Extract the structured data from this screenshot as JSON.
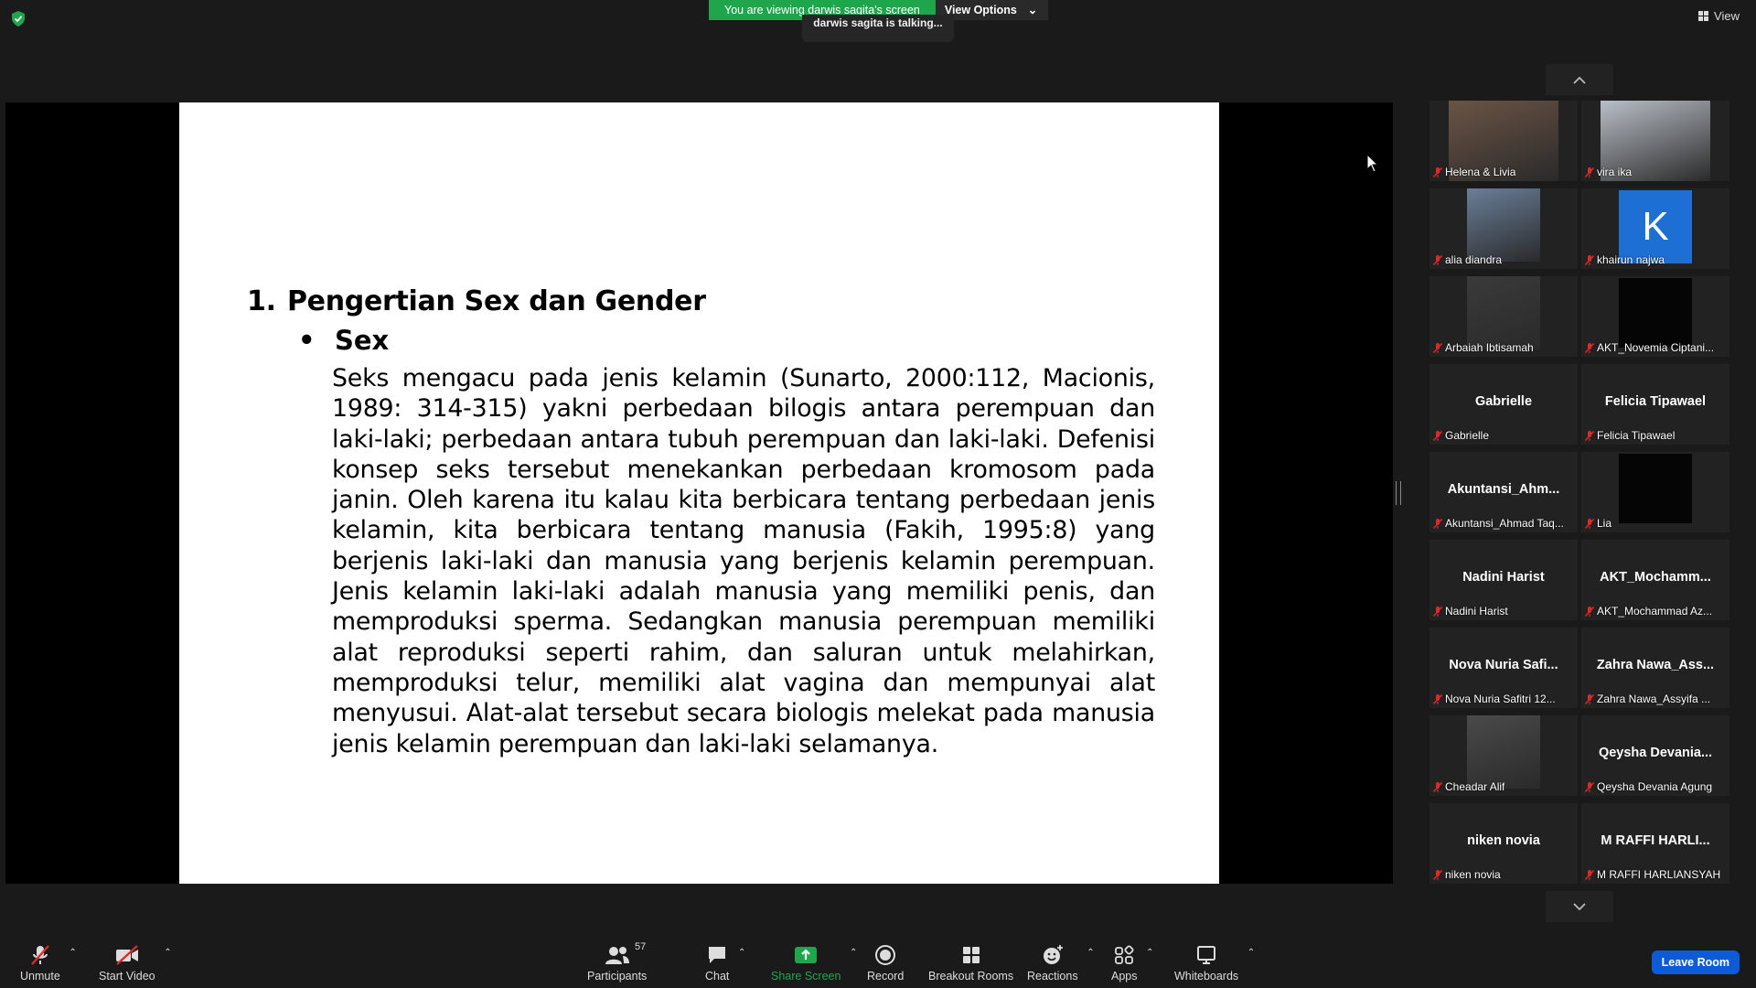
{
  "top": {
    "banner_text": "You are viewing darwis sagita's screen",
    "view_options_label": "View Options",
    "talking_text": "darwis sagita is talking...",
    "view_label": "View"
  },
  "slide": {
    "heading_number": "1.",
    "heading": "Pengertian Sex dan Gender",
    "bullet": "•",
    "subheading": "Sex",
    "body": "Seks mengacu pada jenis kelamin (Sunarto, 2000:112, Macionis, 1989: 314-315) yakni perbedaan bilogis antara perempuan dan laki-laki; perbedaan antara tubuh perempuan dan laki-laki. Defenisi konsep seks tersebut menekankan perbedaan kromosom pada janin. Oleh karena itu kalau kita berbicara tentang perbedaan jenis kelamin, kita berbicara tentang manusia (Fakih, 1995:8) yang berjenis laki-laki dan manusia yang berjenis kelamin perempuan. Jenis kelamin laki-laki adalah manusia yang memiliki penis, dan memproduksi sperma. Sedangkan manusia perempuan memiliki alat reproduksi seperti rahim, dan saluran untuk melahirkan, memproduksi telur, memiliki alat vagina dan mempunyai alat menyusui. Alat-alat tersebut secara biologis melekat pada manusia jenis kelamin perempuan dan laki-laki selamanya."
  },
  "participants": [
    {
      "label": "Helena & Livia",
      "display": "",
      "kind": "video"
    },
    {
      "label": "vira ika",
      "display": "",
      "kind": "video"
    },
    {
      "label": "alia diandra",
      "display": "",
      "kind": "video"
    },
    {
      "label": "khairun najwa",
      "display": "K",
      "kind": "avatar"
    },
    {
      "label": "Arbaiah Ibtisamah",
      "display": "",
      "kind": "video"
    },
    {
      "label": "AKT_Novemia Ciptani...",
      "display": "",
      "kind": "dark"
    },
    {
      "label": "Gabrielle",
      "display": "Gabrielle",
      "kind": "name"
    },
    {
      "label": "Felicia Tipawael",
      "display": "Felicia Tipawael",
      "kind": "name"
    },
    {
      "label": "Akuntansi_Ahmad Taq...",
      "display": "Akuntansi_Ahm...",
      "kind": "name"
    },
    {
      "label": "Lia",
      "display": "",
      "kind": "dark"
    },
    {
      "label": "Nadini Harist",
      "display": "Nadini Harist",
      "kind": "name"
    },
    {
      "label": "AKT_Mochammad Az...",
      "display": "AKT_Mochamm...",
      "kind": "name"
    },
    {
      "label": "Nova Nuria Safitri 12...",
      "display": "Nova Nuria Safi...",
      "kind": "name"
    },
    {
      "label": "Zahra Nawa_Assyifa ...",
      "display": "Zahra Nawa_Ass...",
      "kind": "name"
    },
    {
      "label": "Cheadar Alif",
      "display": "",
      "kind": "video"
    },
    {
      "label": "Qeysha Devania Agung",
      "display": "Qeysha Devania...",
      "kind": "name"
    },
    {
      "label": "niken novia",
      "display": "niken novia",
      "kind": "name"
    },
    {
      "label": "M RAFFI HARLIANSYAH",
      "display": "M RAFFI HARLI...",
      "kind": "name"
    }
  ],
  "toolbar": {
    "unmute": "Unmute",
    "start_video": "Start Video",
    "participants": "Participants",
    "participant_count": "57",
    "chat": "Chat",
    "share_screen": "Share Screen",
    "record": "Record",
    "breakout_rooms": "Breakout Rooms",
    "reactions": "Reactions",
    "apps": "Apps",
    "whiteboards": "Whiteboards",
    "leave": "Leave Room"
  },
  "colors": {
    "banner_green": "#1fa64c",
    "share_green": "#1fa64c",
    "leave_blue": "#0e5bd8",
    "mic_red": "#e02828",
    "avatar_blue": "#1e6fd3"
  }
}
